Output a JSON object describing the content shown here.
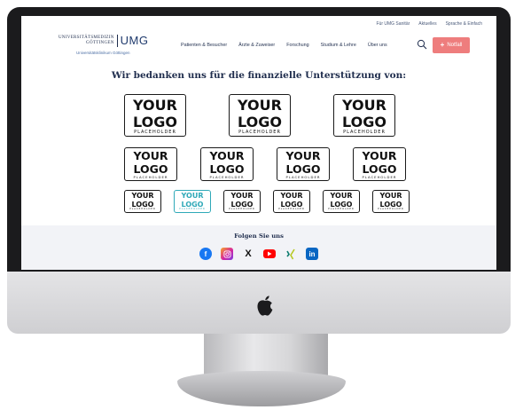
{
  "top_links": [
    "Für UMG Sanitär",
    "Aktuelles",
    "Sprache & Einfach"
  ],
  "logo": {
    "university_line1": "UNIVERSITÄTSMEDIZIN",
    "university_line2": "GÖTTINGEN",
    "brand": "UMG",
    "subtitle": "Universitätsklinikum Göttingen"
  },
  "nav": [
    "Patienten & Besucher",
    "Ärzte & Zuweiser",
    "Forschung",
    "Studium & Lehre",
    "Über uns"
  ],
  "notfall_label": "Notfall",
  "heading": "Wir bedanken uns für die finanzielle Unterstützung von:",
  "logo_placeholder": {
    "line1": "YOUR",
    "line2": "LOGO",
    "line3": "PLACEHOLDER"
  },
  "footer": {
    "follow": "Folgen Sie uns"
  },
  "social": [
    "facebook",
    "instagram",
    "x",
    "youtube",
    "xing",
    "linkedin"
  ],
  "colors": {
    "navy": "#1f2d4d",
    "notfall": "#ee7d7d",
    "teal": "#2fa9b8",
    "footer_bg": "#f2f3f7",
    "facebook": "#1877f2",
    "instagram": "#d6249f",
    "youtube": "#ff0000",
    "xing": "#0a7a6e",
    "linkedin": "#0a66c2"
  }
}
